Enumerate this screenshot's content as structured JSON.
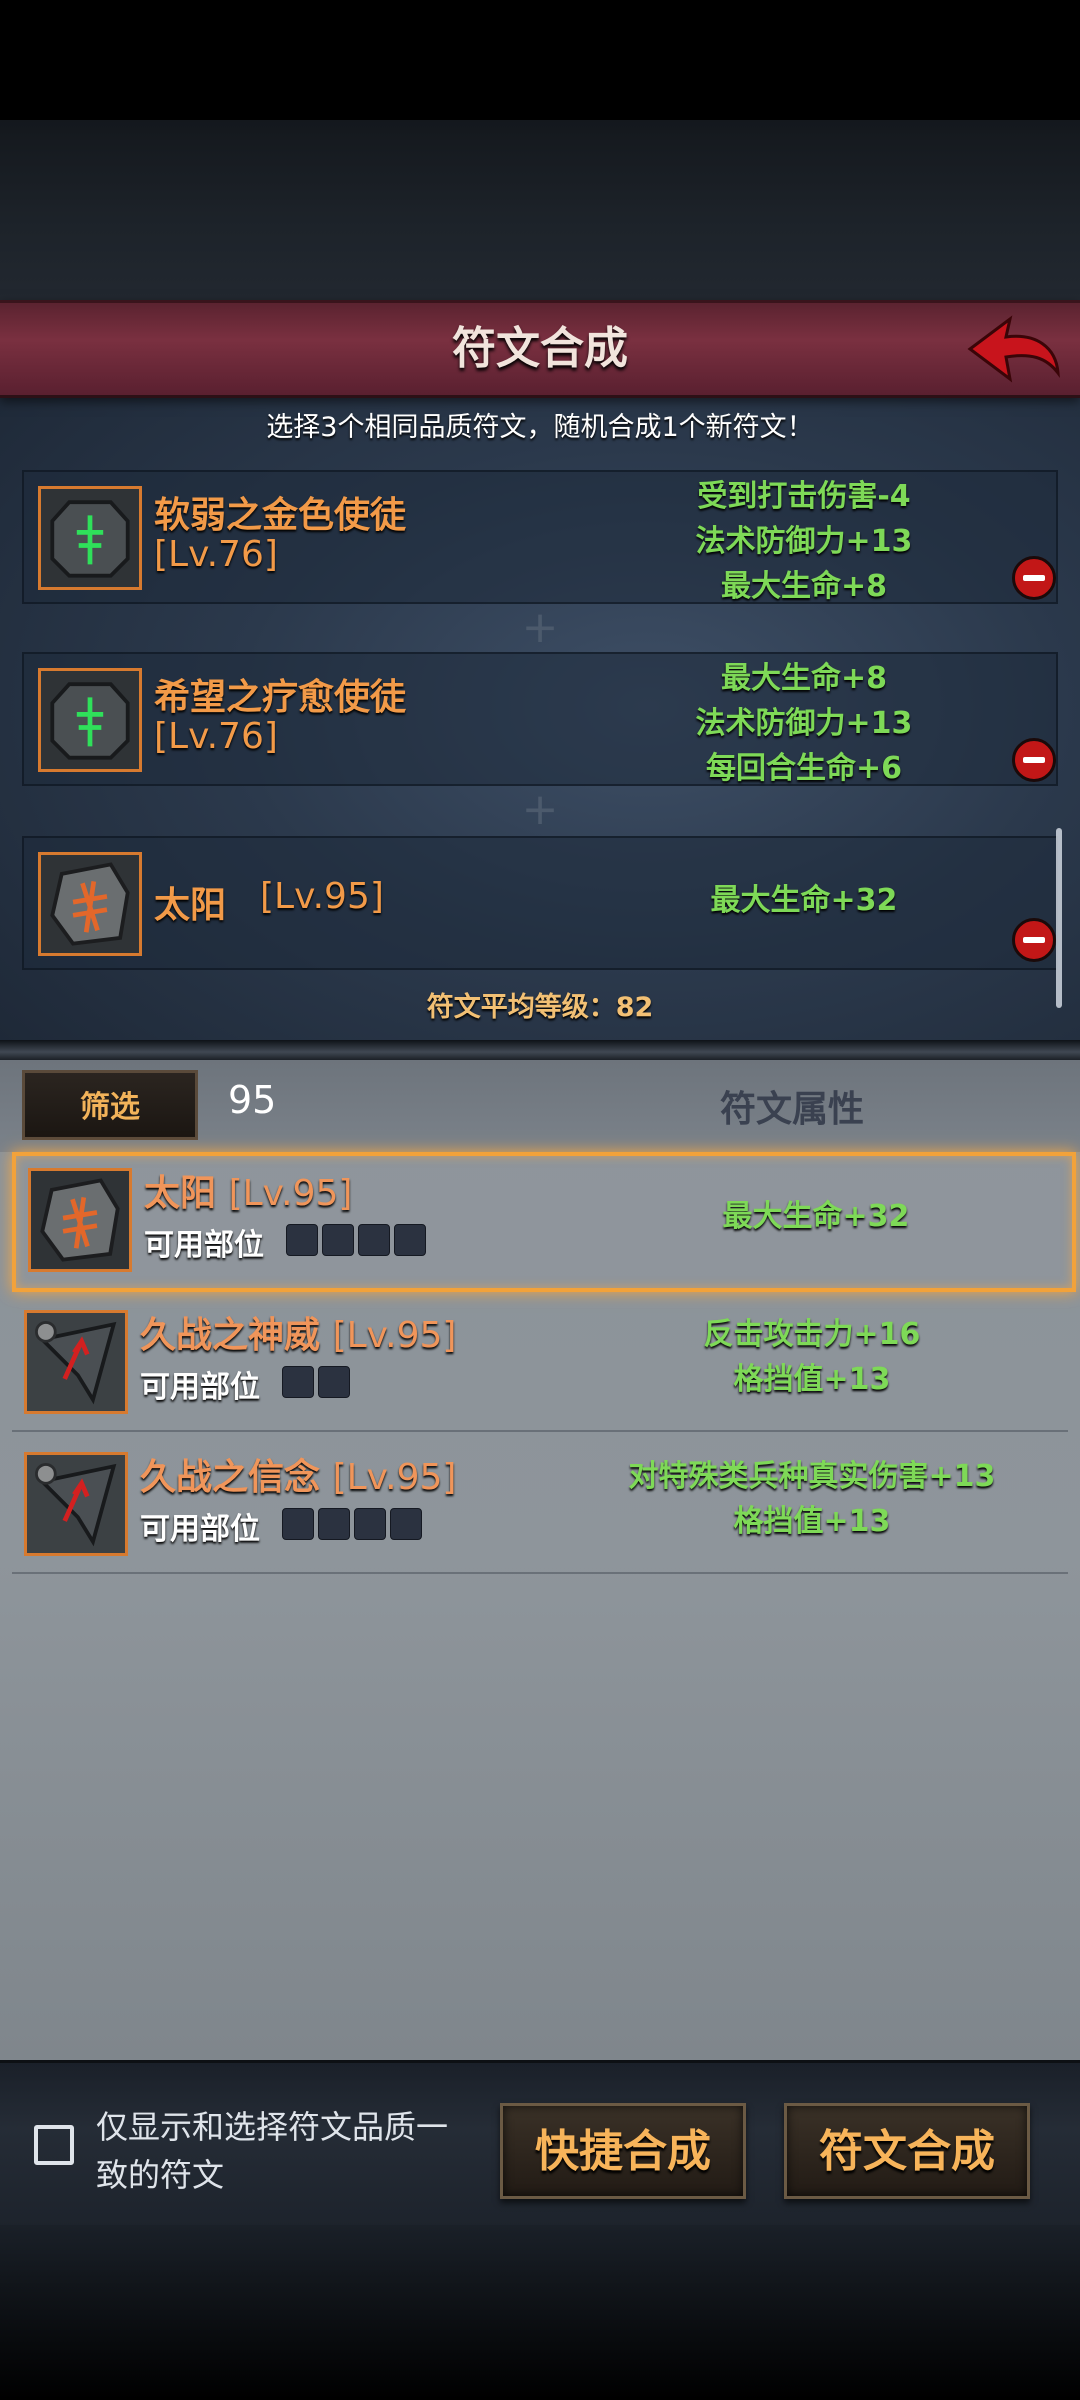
{
  "header": {
    "title": "符文合成"
  },
  "instruction": "选择3个相同品质符文，随机合成1个新符文！",
  "slots": [
    {
      "name": "软弱之金色使徒",
      "level": "[Lv.76]",
      "attrs": [
        "受到打击伤害-4",
        "法术防御力+13",
        "最大生命+8"
      ]
    },
    {
      "name": "希望之疗愈使徒",
      "level": "[Lv.76]",
      "attrs": [
        "最大生命+8",
        "法术防御力+13",
        "每回合生命+6"
      ]
    },
    {
      "name": "太阳",
      "level": "[Lv.95]",
      "attrs": [
        "最大生命+32"
      ]
    }
  ],
  "avg_level": "符文平均等级：82",
  "filter": {
    "button": "筛选",
    "value": "95",
    "header": "符文属性"
  },
  "list": [
    {
      "name": "太阳",
      "level": "[Lv.95]",
      "usable": "可用部位",
      "attrs": [
        "最大生命+32"
      ]
    },
    {
      "name": "久战之神威",
      "level": "[Lv.95]",
      "usable": "可用部位",
      "attrs": [
        "反击攻击力+16",
        "格挡值+13"
      ]
    },
    {
      "name": "久战之信念",
      "level": "[Lv.95]",
      "usable": "可用部位",
      "attrs": [
        "对特殊类兵种真实伤害+13",
        "格挡值+13"
      ]
    }
  ],
  "bottom": {
    "checkbox_label": "仅显示和选择符文品质一致的符文",
    "quick_btn": "快捷合成",
    "synth_btn": "符文合成"
  },
  "colors": {
    "accent_orange": "#f29a48",
    "attr_green": "#7ed957",
    "title_bar": "#7a3040"
  }
}
